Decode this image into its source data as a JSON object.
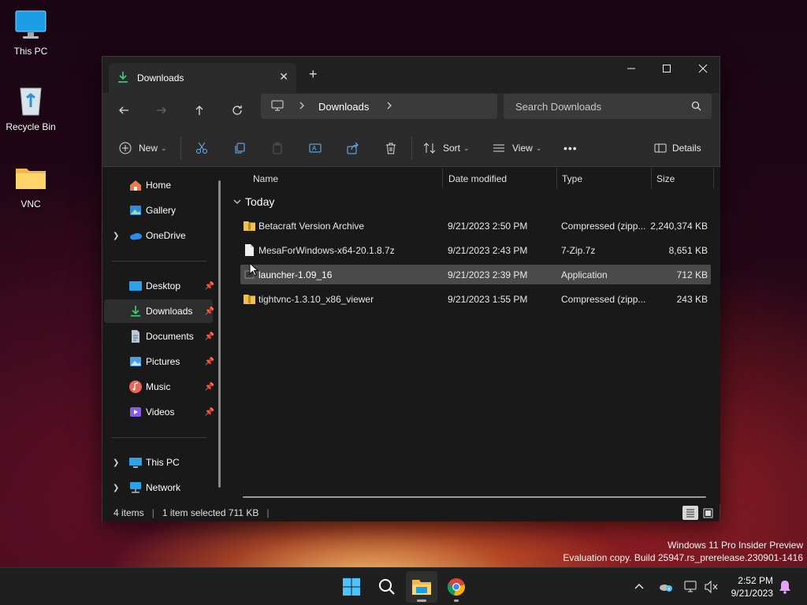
{
  "desktop": {
    "icons": [
      {
        "label": "This PC"
      },
      {
        "label": "Recycle Bin"
      },
      {
        "label": "VNC"
      }
    ]
  },
  "window": {
    "tab_title": "Downloads",
    "tab_close": "✕",
    "new_tab": "+",
    "controls": {
      "minimize": "—",
      "maximize": "☐",
      "close": "✕"
    }
  },
  "nav": {
    "breadcrumb": [
      "Downloads"
    ],
    "search_placeholder": "Search Downloads"
  },
  "commands": {
    "new": "New",
    "sort": "Sort",
    "view": "View",
    "more": "•••",
    "details": "Details"
  },
  "sidebar": {
    "items": [
      {
        "label": "Home",
        "icon": "home-icon"
      },
      {
        "label": "Gallery",
        "icon": "gallery-icon"
      },
      {
        "label": "OneDrive",
        "icon": "onedrive-icon"
      },
      {
        "label": "Desktop",
        "icon": "desktop-icon"
      },
      {
        "label": "Downloads",
        "icon": "download-icon"
      },
      {
        "label": "Documents",
        "icon": "documents-icon"
      },
      {
        "label": "Pictures",
        "icon": "pictures-icon"
      },
      {
        "label": "Music",
        "icon": "music-icon"
      },
      {
        "label": "Videos",
        "icon": "videos-icon"
      },
      {
        "label": "This PC",
        "icon": "pc-icon"
      },
      {
        "label": "Network",
        "icon": "network-icon"
      }
    ]
  },
  "files": {
    "columns": [
      "Name",
      "Date modified",
      "Type",
      "Size"
    ],
    "group": "Today",
    "rows": [
      {
        "name": "Betacraft Version Archive",
        "date": "9/21/2023 2:50 PM",
        "type": "Compressed (zipp...",
        "size": "2,240,374 KB",
        "icon": "zip-folder-icon"
      },
      {
        "name": "MesaForWindows-x64-20.1.8.7z",
        "date": "9/21/2023 2:43 PM",
        "type": "7-Zip.7z",
        "size": "8,651 KB",
        "icon": "file-icon"
      },
      {
        "name": "launcher-1.09_16",
        "date": "9/21/2023 2:39 PM",
        "type": "Application",
        "size": "712 KB",
        "icon": "application-icon"
      },
      {
        "name": "tightvnc-1.3.10_x86_viewer",
        "date": "9/21/2023 1:55 PM",
        "type": "Compressed (zipp...",
        "size": "243 KB",
        "icon": "zip-folder-icon"
      }
    ]
  },
  "status": {
    "items": "4 items",
    "selected": "1 item selected  711 KB"
  },
  "watermark": {
    "line1": "Windows 11 Pro Insider Preview",
    "line2": "Evaluation copy. Build 25947.rs_prerelease.230901-1416"
  },
  "taskbar": {
    "time": "2:52 PM",
    "date": "9/21/2023"
  },
  "colors": {
    "accent": "#4cc2ff",
    "folder": "#f2c04c",
    "download_green": "#3ad17b"
  }
}
